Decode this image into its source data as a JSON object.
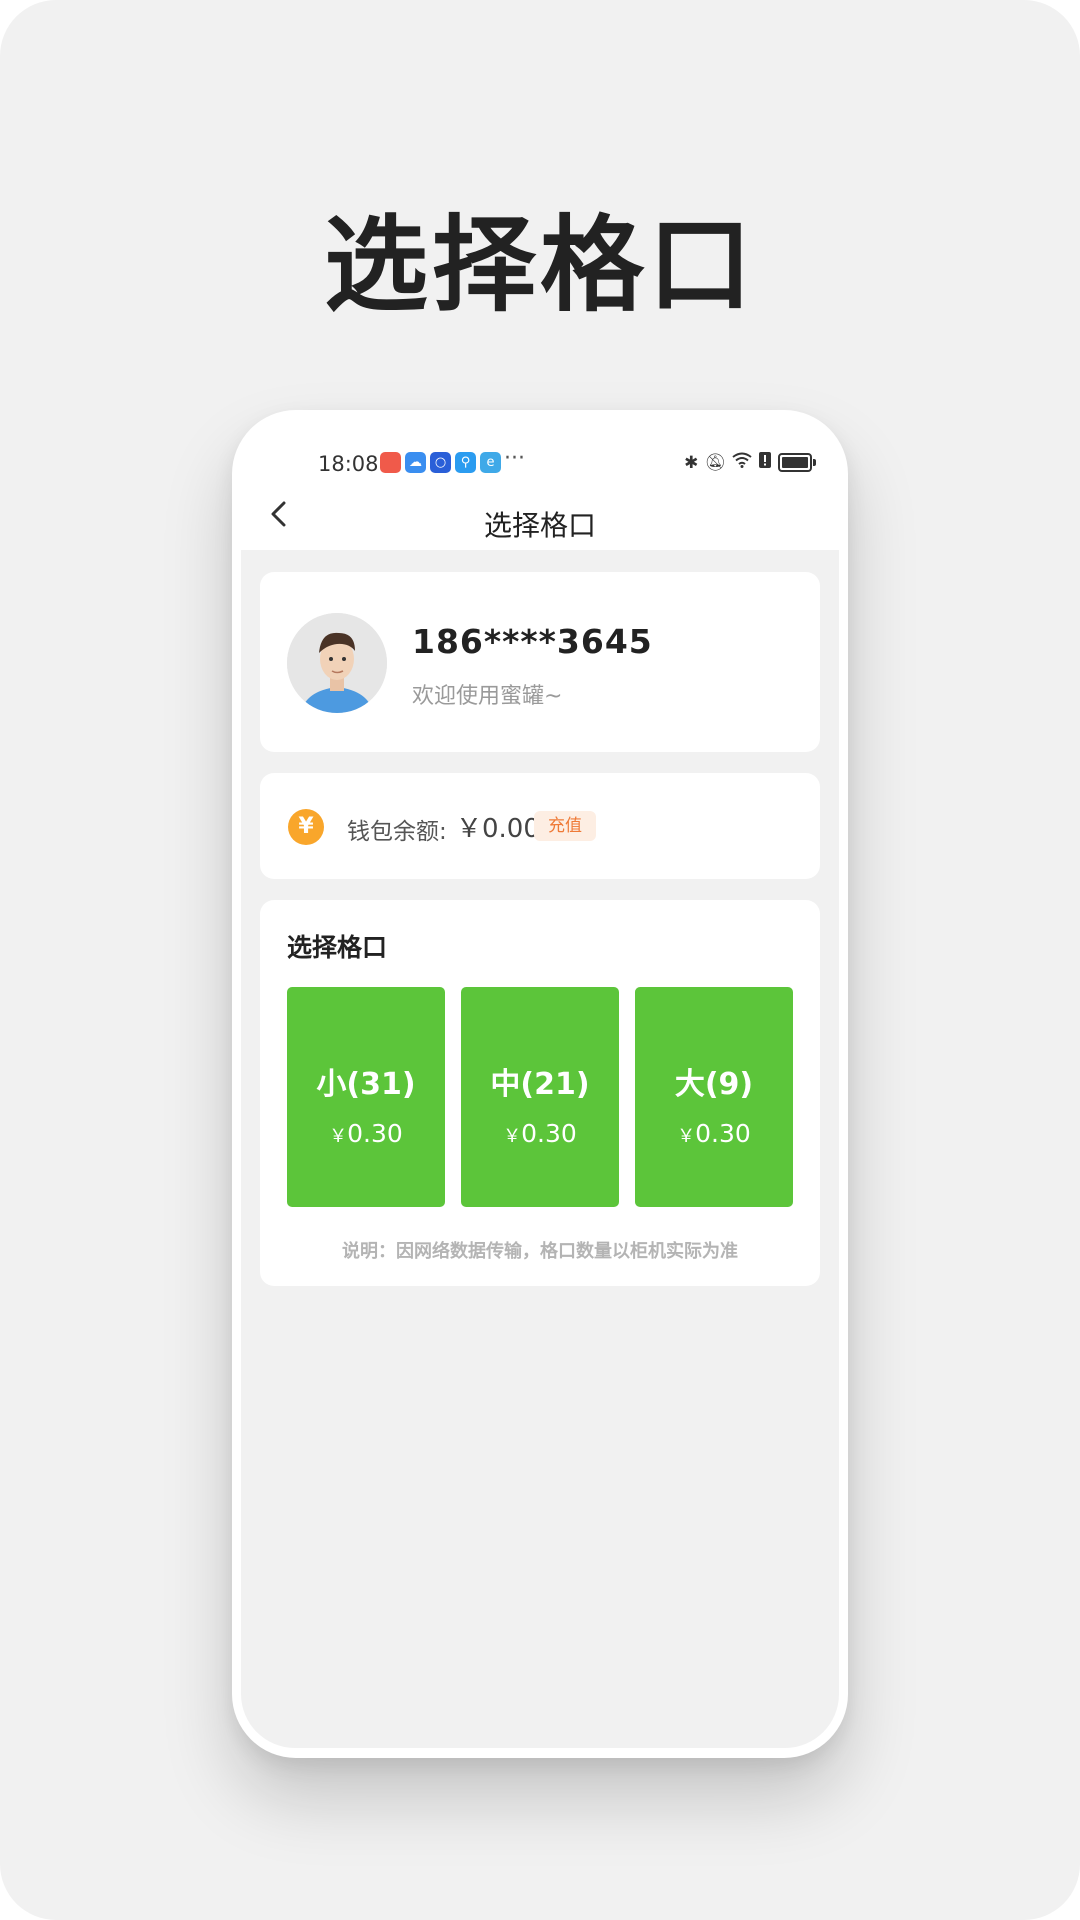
{
  "headline": "选择格口",
  "status": {
    "time": "18:08",
    "dots": "···"
  },
  "nav": {
    "title": "选择格口"
  },
  "profile": {
    "phone": "186****3645",
    "welcome": "欢迎使用蜜罐~"
  },
  "wallet": {
    "label": "钱包余额:",
    "amount": "￥0.00",
    "icon_text": "¥",
    "recharge_label": "充值"
  },
  "cells_section": {
    "title": "选择格口",
    "cells": [
      {
        "name": "小(31)",
        "yen": "￥",
        "price": "0.30"
      },
      {
        "name": "中(21)",
        "yen": "￥",
        "price": "0.30"
      },
      {
        "name": "大(9)",
        "yen": "￥",
        "price": "0.30"
      }
    ],
    "note": "说明：因网络数据传输，格口数量以柜机实际为准"
  },
  "colors": {
    "accent_green": "#5cc53a",
    "coin_orange": "#f9a62b",
    "recharge_text": "#ef7a37"
  }
}
